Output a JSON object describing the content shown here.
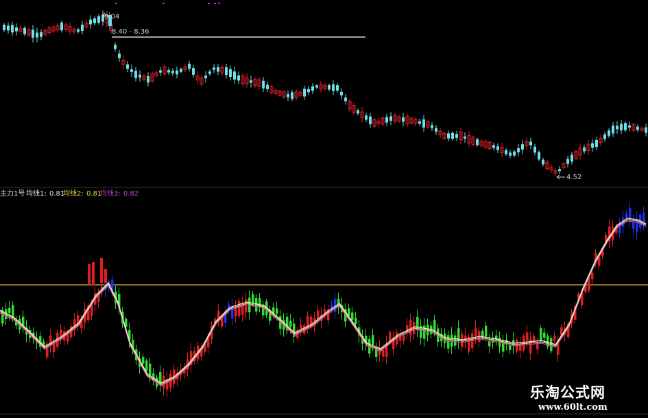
{
  "price_panel": {
    "high_label": "9.04",
    "range_label": "8.40 - 8.36",
    "low_label": "4.52"
  },
  "indicator_panel": {
    "name": "主力1号",
    "ma1": {
      "label": "均线1:",
      "value": "0.81",
      "color": "#e8e8e8"
    },
    "ma2": {
      "label": "均线2:",
      "value": "0.81",
      "color": "#e8d84a"
    },
    "ma3": {
      "label": "均线3:",
      "value": "0.82",
      "color": "#c040d0"
    },
    "reference_line_color": "#b8a020"
  },
  "colors": {
    "up": "#e0202a",
    "down": "#70e0e8",
    "ind_up": "#e02020",
    "ind_down": "#30e030",
    "ind_blue": "#2030e8",
    "magenta": "#c030c0"
  },
  "watermark": {
    "name": "乐淘公式网",
    "url": "www.60lt.com"
  }
}
